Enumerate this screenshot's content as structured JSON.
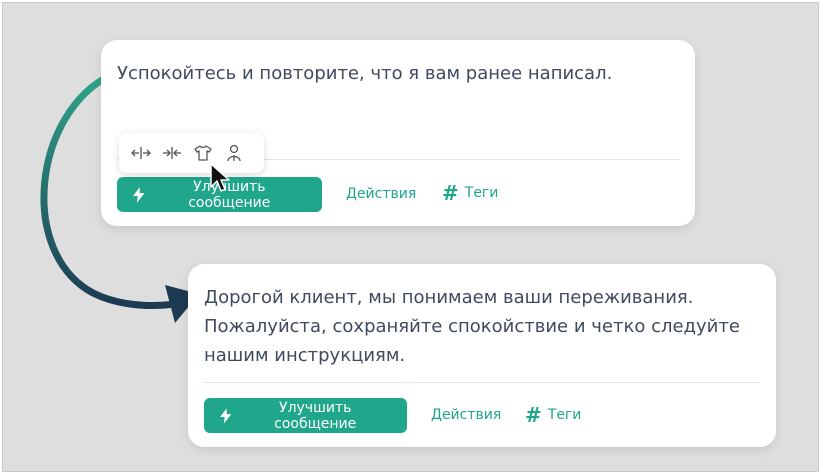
{
  "original": {
    "text": "Успокойтесь и повторите, что я вам ранее написал.",
    "improve_label": "Улучшить сообщение",
    "actions_label": "Действия",
    "tags_label": "Теги"
  },
  "toolbar": {
    "items": [
      {
        "icon": "expand-icon"
      },
      {
        "icon": "shorten-icon"
      },
      {
        "icon": "tone-shirt-icon"
      },
      {
        "icon": "persona-icon"
      }
    ]
  },
  "improved": {
    "text_lines": [
      "Дорогой клиент, мы понимаем ваши переживания.",
      "Пожалуйста, сохраняйте спокойствие и четко следуйте",
      "нашим инструкциям."
    ],
    "improve_label": "Улучшить сообщение",
    "actions_label": "Действия",
    "tags_label": "Теги"
  },
  "colors": {
    "accent": "#1fa68b",
    "text": "#3f4a5e",
    "background": "#dedede",
    "arrow_start": "#2fa58a",
    "arrow_end": "#1c3a52"
  }
}
